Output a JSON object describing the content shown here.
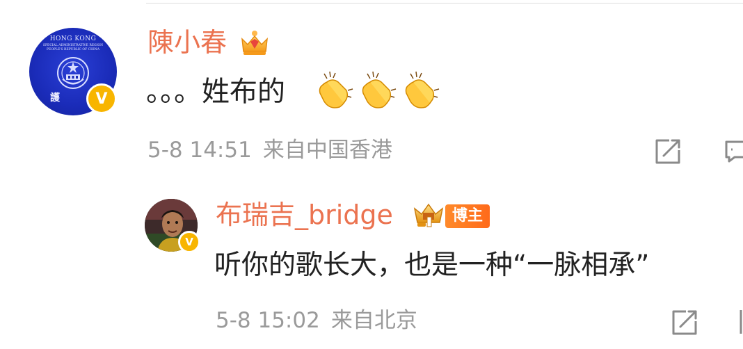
{
  "comment": {
    "username": "陳小春",
    "text": "。。。姓布的",
    "emoji": "clapping-hands",
    "emoji_count": 3,
    "timestamp": "5-8 14:51",
    "location": "来自中国香港",
    "avatar": {
      "line1": "HONG KONG",
      "line2": "SPECIAL ADMINISTRATIVE REGION",
      "line3": "PEOPLE'S REPUBLIC OF CHINA",
      "line4": "護"
    },
    "verified_mark": "V"
  },
  "reply": {
    "username": "布瑞吉_bridge",
    "badge": "博主",
    "text": "听你的歌长大，也是一种“一脉相承”",
    "timestamp": "5-8 15:02",
    "location": "来自北京",
    "verified_mark": "V"
  },
  "colors": {
    "username": "#eb7350",
    "meta": "#9a9a9a",
    "text": "#222222",
    "verified": "#f8b500",
    "badge": "#ff7a22"
  },
  "icons": [
    "crown-icon",
    "clapping-hands-icon",
    "share-icon",
    "comment-icon",
    "verified-icon"
  ]
}
